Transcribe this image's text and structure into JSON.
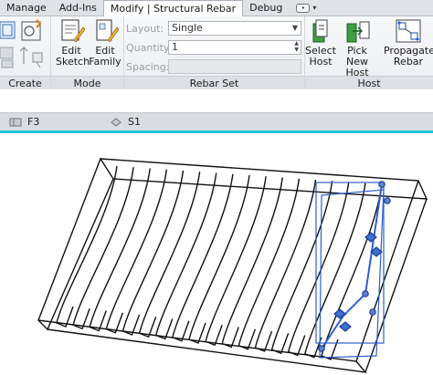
{
  "tabs": [
    {
      "label": "Manage",
      "active": false
    },
    {
      "label": "Add-Ins",
      "active": false
    },
    {
      "label": "Modify | Structural Rebar",
      "active": true
    },
    {
      "label": "Debug",
      "active": false
    }
  ],
  "panels": {
    "create": {
      "title": "Create"
    },
    "mode": {
      "title": "Mode",
      "edit_sketch": {
        "line1": "Edit",
        "line2": "Sketch"
      },
      "edit_family": {
        "line1": "Edit",
        "line2": "Family"
      }
    },
    "rebar_set": {
      "title": "Rebar Set",
      "layout_label": "Layout:",
      "layout_value": "Single",
      "quantity_label": "Quantity:",
      "quantity_value": "1",
      "spacing_label": "Spacing:",
      "spacing_value": ""
    },
    "host": {
      "title": "Host",
      "select_host": {
        "line1": "Select",
        "line2": "Host"
      },
      "pick_new_host": {
        "line1": "Pick New",
        "line2": "Host"
      },
      "propagate_rebar": {
        "line1": "Propagate",
        "line2": "Rebar"
      }
    }
  },
  "viewbar": {
    "view1": "F3",
    "view2": "S1"
  },
  "colors": {
    "accent_line": "#22c3d6",
    "selection_blue": "#2f5fcf",
    "rebar_black": "#111111"
  }
}
